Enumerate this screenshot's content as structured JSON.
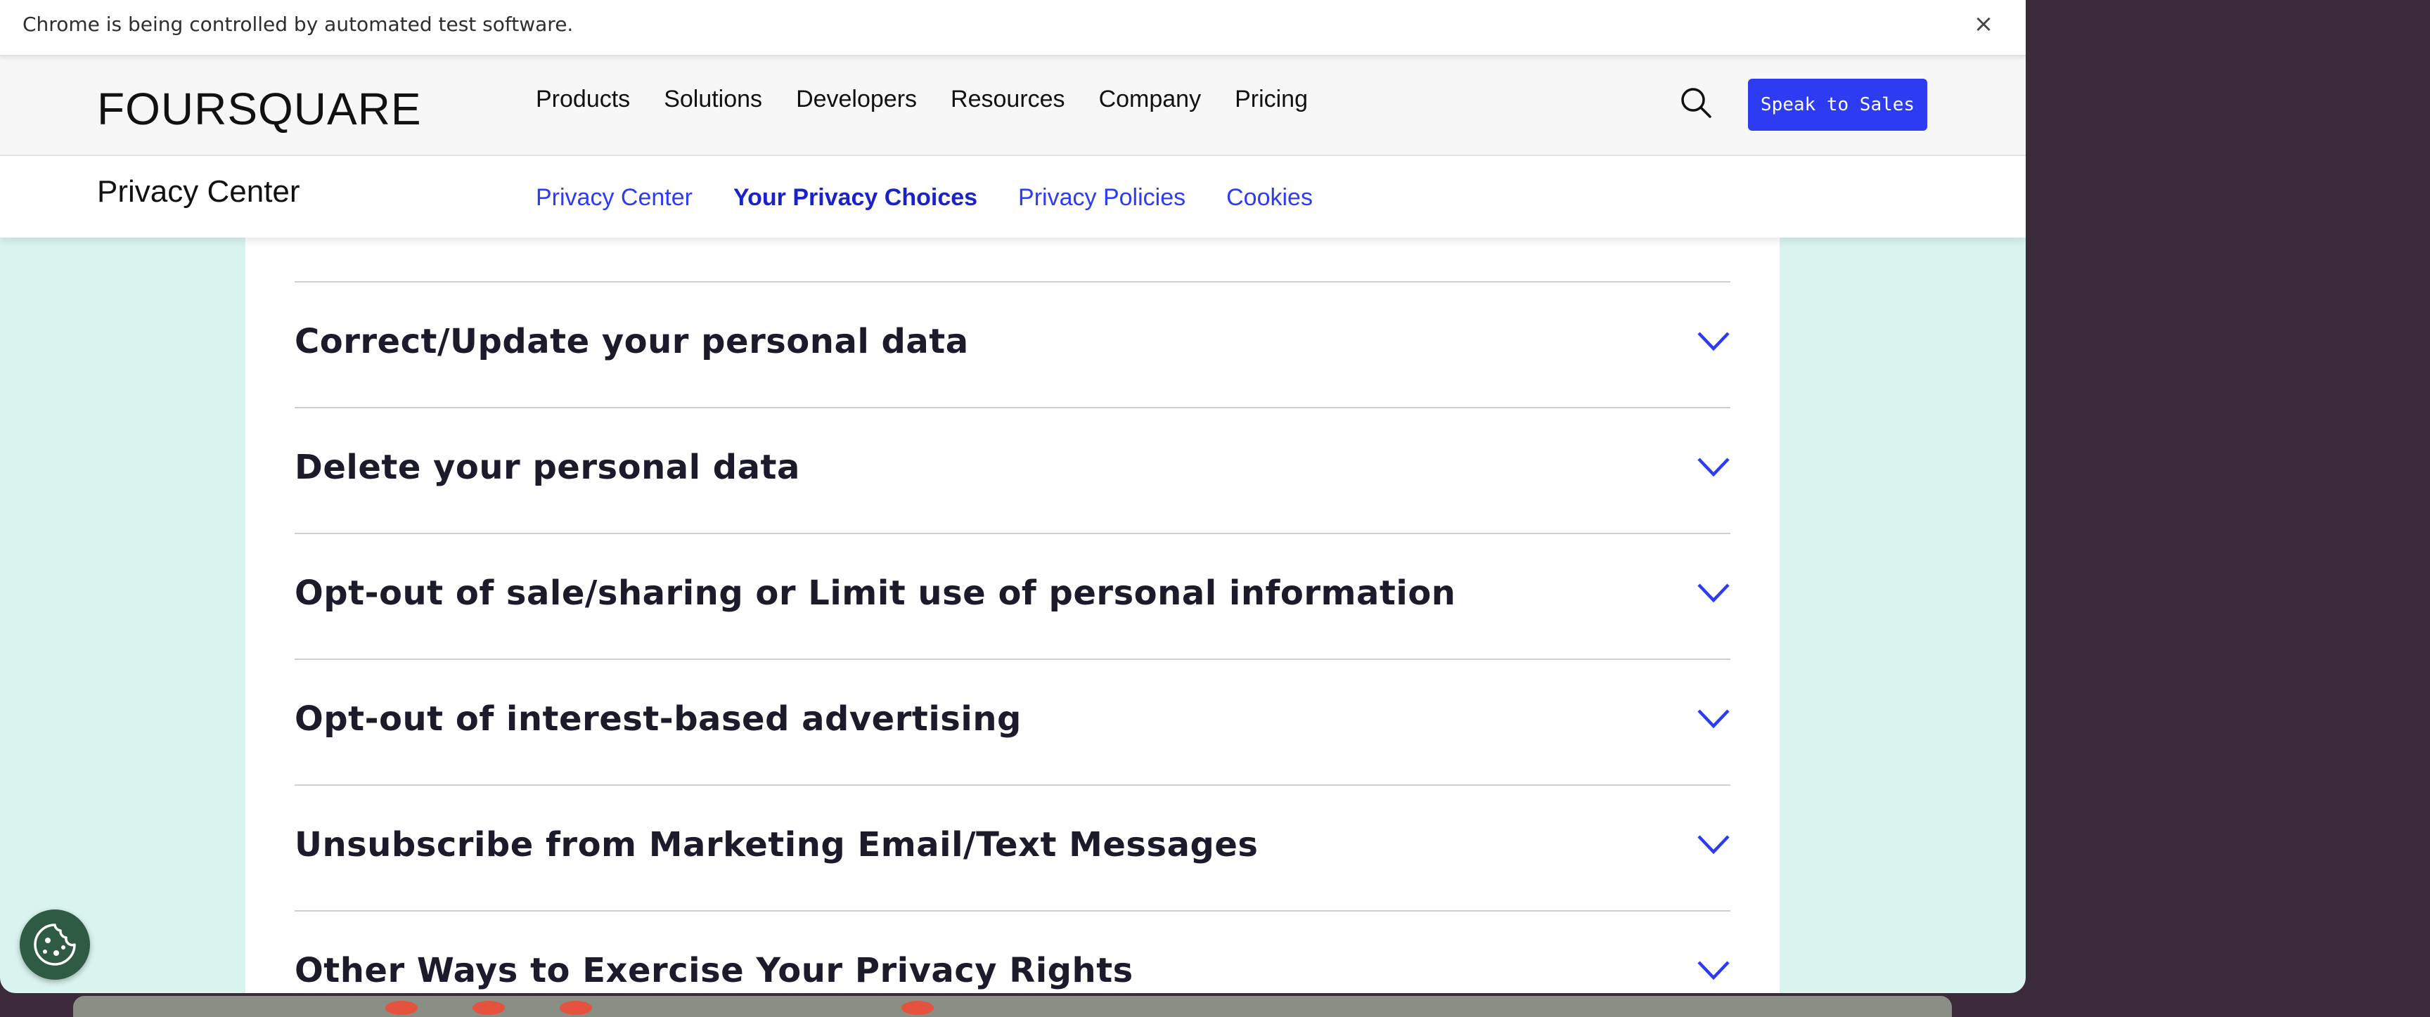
{
  "automation_bar": {
    "message": "Chrome is being controlled by automated test software.",
    "close_glyph": "×"
  },
  "header": {
    "logo": "FOURSQUARE",
    "nav": [
      "Products",
      "Solutions",
      "Developers",
      "Resources",
      "Company",
      "Pricing"
    ],
    "search_icon": "search-icon",
    "cta_label": "Speak to Sales",
    "accent_color": "#2d3cf2"
  },
  "subnav": {
    "title": "Privacy Center",
    "links": [
      {
        "label": "Privacy Center",
        "active": false
      },
      {
        "label": "Your Privacy Choices",
        "active": true
      },
      {
        "label": "Privacy Policies",
        "active": false
      },
      {
        "label": "Cookies",
        "active": false
      }
    ]
  },
  "main": {
    "accordion": [
      {
        "title": "Correct/Update your personal data"
      },
      {
        "title": "Delete your personal data"
      },
      {
        "title": "Opt-out of sale/sharing or Limit use of personal information"
      },
      {
        "title": "Opt-out of interest-based advertising"
      },
      {
        "title": "Unsubscribe from Marketing Email/Text Messages"
      },
      {
        "title": "Other Ways to Exercise Your Privacy Rights"
      }
    ],
    "expand_icon": "chevron-down-icon"
  },
  "cookie_settings_icon": "cookie-icon",
  "colors": {
    "page_background": "#d9f3ee",
    "chevron": "#2d3cf2"
  }
}
